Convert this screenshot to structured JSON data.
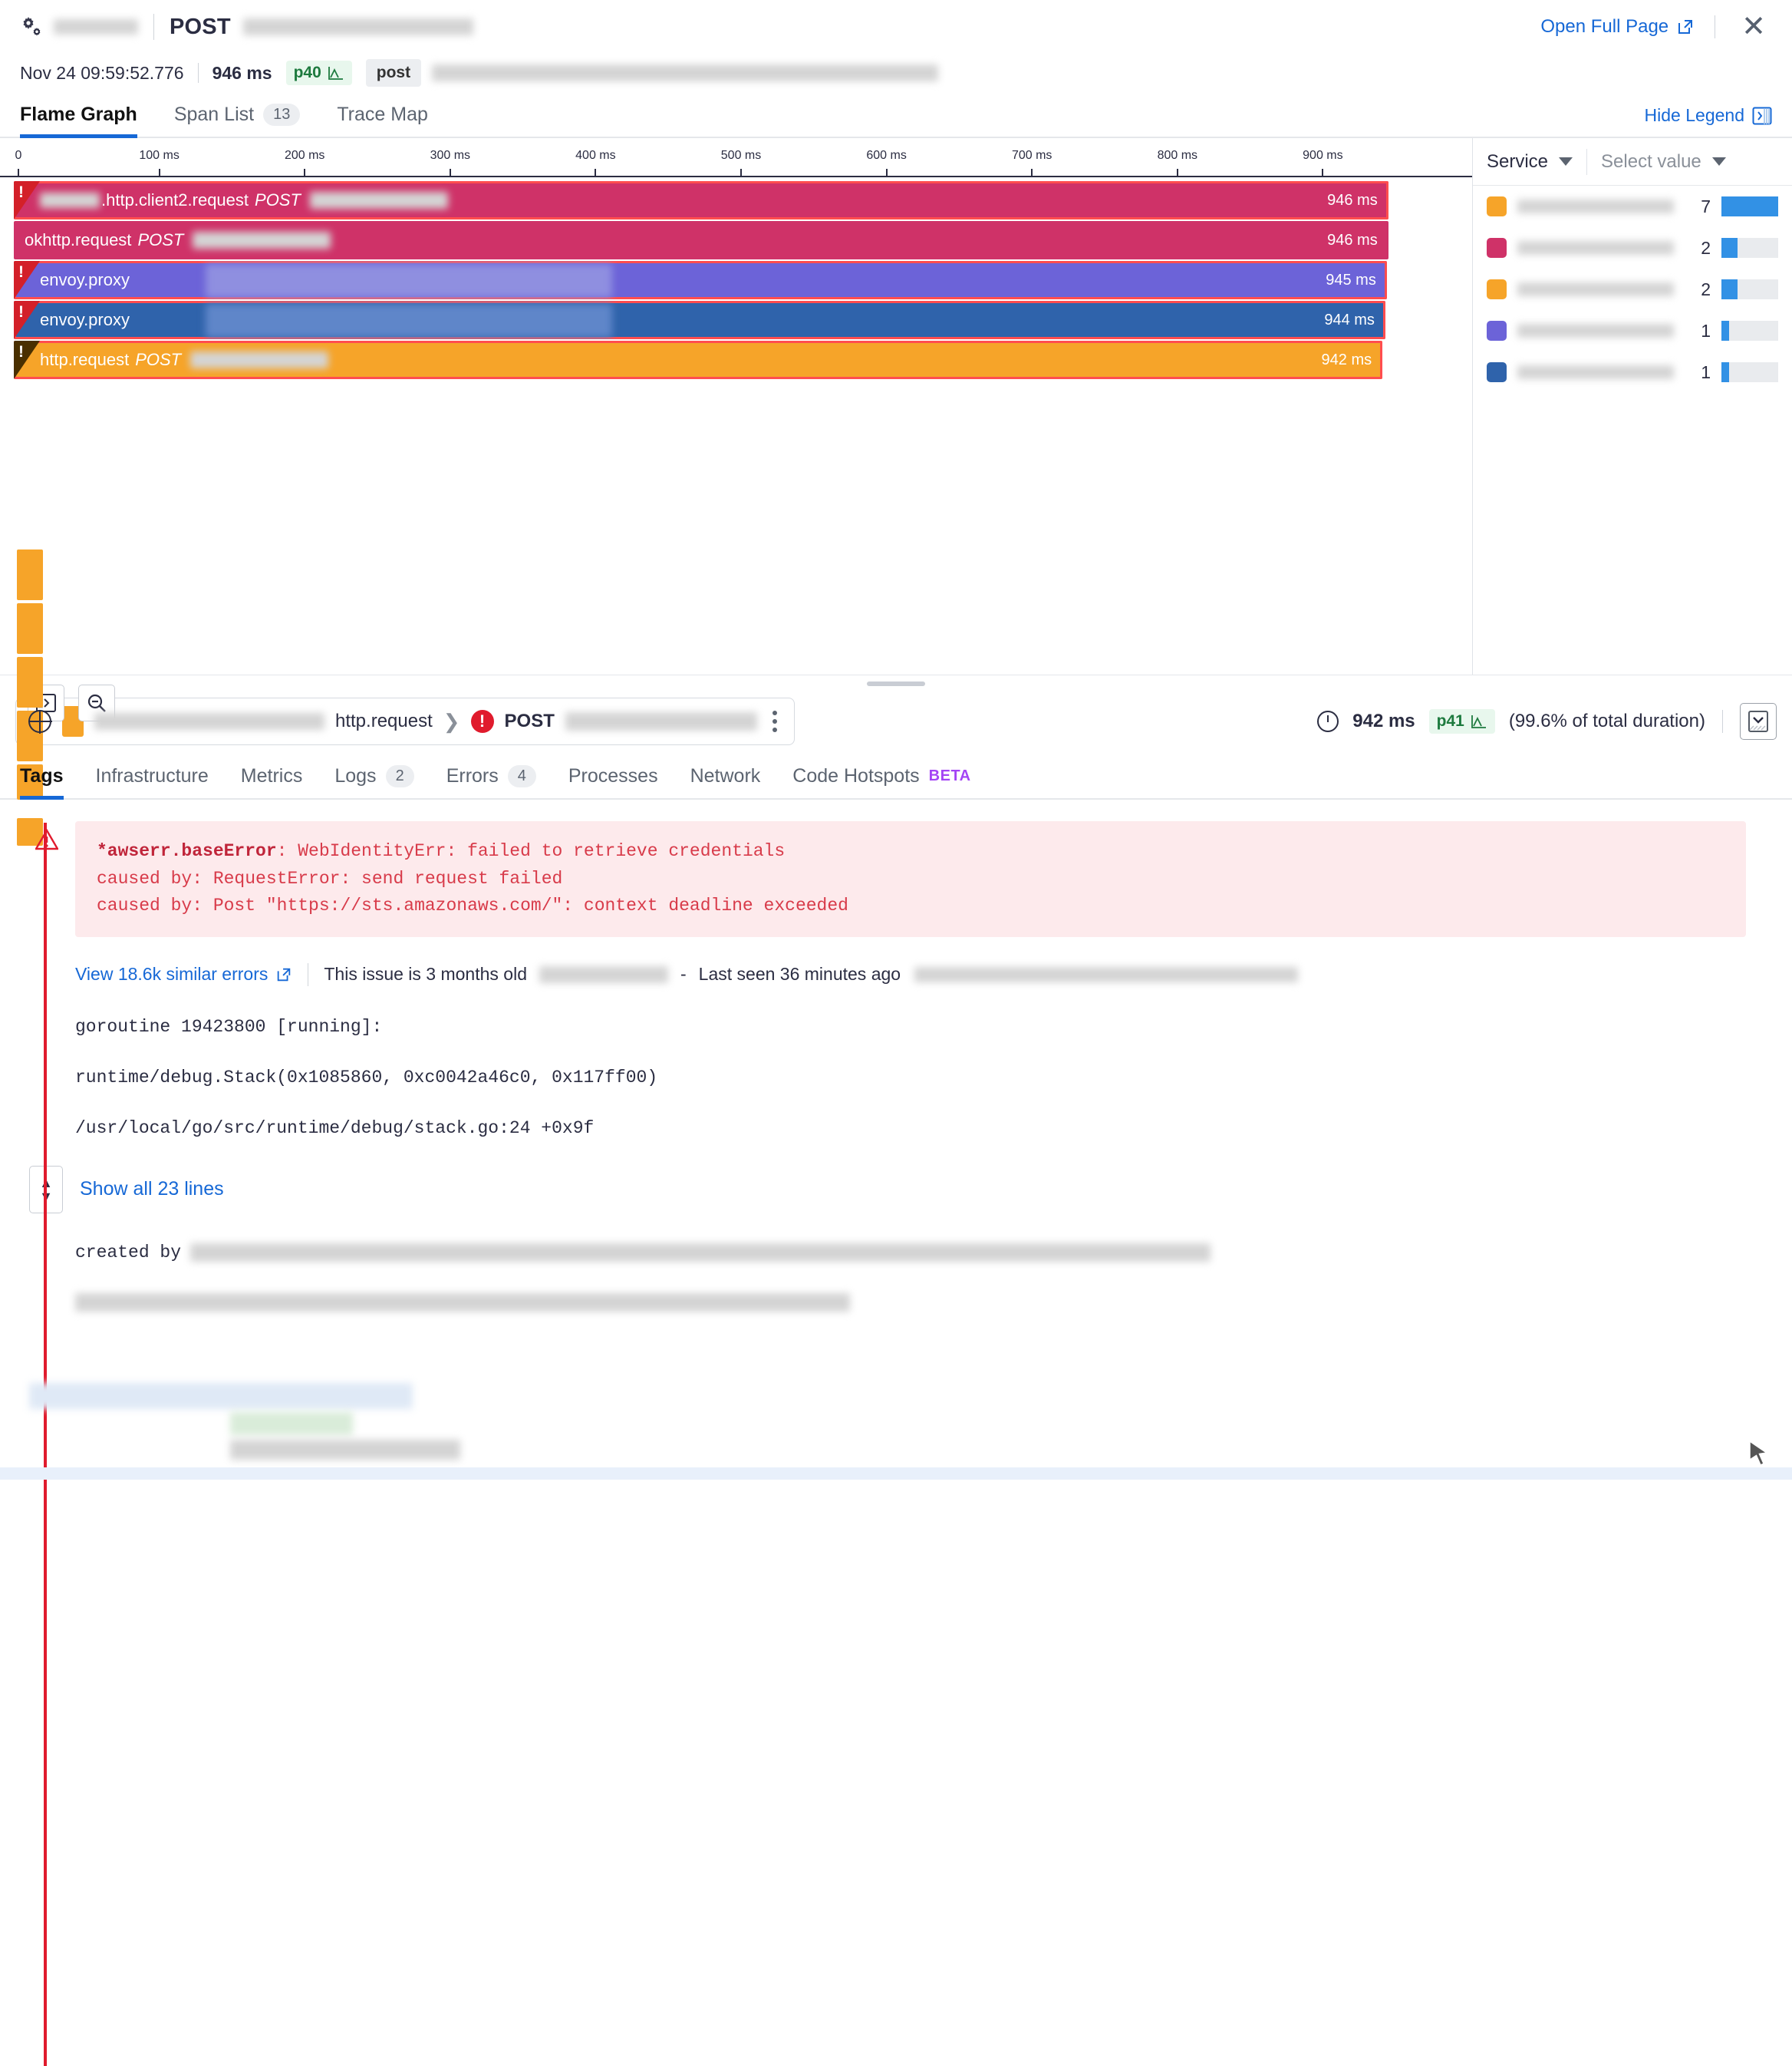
{
  "header": {
    "service_name_redacted": true,
    "method": "POST",
    "resource_redacted": true,
    "open_full_page": "Open Full Page",
    "close_icon": "close-icon",
    "settings_icon": "gears-icon"
  },
  "meta": {
    "timestamp": "Nov 24 09:59:52.776",
    "duration": "946 ms",
    "percentile_badge": "p40",
    "type_chip": "post"
  },
  "trace_tabs": {
    "items": [
      {
        "label": "Flame Graph",
        "count": null,
        "active": true
      },
      {
        "label": "Span List",
        "count": "13",
        "active": false
      },
      {
        "label": "Trace Map",
        "count": null,
        "active": false
      }
    ],
    "hide_legend": "Hide Legend"
  },
  "flame_graph": {
    "axis": {
      "ticks": [
        "0",
        "100 ms",
        "200 ms",
        "300 ms",
        "400 ms",
        "500 ms",
        "600 ms",
        "700 ms",
        "800 ms",
        "900 ms"
      ],
      "max_ms": 1000
    },
    "spans": [
      {
        "name": ".http.client2.request",
        "method": "POST",
        "duration": "946 ms",
        "duration_ms": 946,
        "start_ms": 0,
        "color": "#cf3268",
        "error": true,
        "redacted_prefix": true,
        "redacted_resource": true
      },
      {
        "name": "okhttp.request",
        "method": "POST",
        "duration": "946 ms",
        "duration_ms": 946,
        "start_ms": 0,
        "color": "#cf3268",
        "error": false,
        "redacted_prefix": false,
        "redacted_resource": true
      },
      {
        "name": "envoy.proxy",
        "method": "",
        "duration": "945 ms",
        "duration_ms": 945,
        "start_ms": 0,
        "color": "#6c63d8",
        "error": true,
        "redacted_prefix": false,
        "redacted_resource": false
      },
      {
        "name": "envoy.proxy",
        "method": "",
        "duration": "944 ms",
        "duration_ms": 944,
        "start_ms": 0,
        "color": "#2f63ab",
        "error": true,
        "redacted_prefix": false,
        "redacted_resource": false
      },
      {
        "name": "http.request",
        "method": "POST",
        "duration": "942 ms",
        "duration_ms": 942,
        "start_ms": 0,
        "color": "#f6a429",
        "error": true,
        "redacted_prefix": false,
        "redacted_resource": true,
        "selected": true
      }
    ],
    "controls": {
      "expand_icon": "expand-collapse-icon",
      "zoom_out_icon": "zoom-out-icon"
    }
  },
  "legend": {
    "group_by": "Service",
    "value_placeholder": "Select value",
    "rows": [
      {
        "color": "#f6a429",
        "count": "7",
        "bar_pct": 100
      },
      {
        "color": "#cf3268",
        "count": "2",
        "bar_pct": 28
      },
      {
        "color": "#f6a429",
        "count": "2",
        "bar_pct": 28
      },
      {
        "color": "#6c63d8",
        "count": "1",
        "bar_pct": 14
      },
      {
        "color": "#2f63ab",
        "count": "1",
        "bar_pct": 14
      }
    ]
  },
  "span_detail": {
    "globe_icon": "globe-icon",
    "operation": "http.request",
    "method": "POST",
    "error_icon": "error-badge-icon",
    "kebab_icon": "kebab-menu-icon",
    "clock_icon": "clock-icon",
    "duration": "942 ms",
    "percentile_badge": "p41",
    "percent_of_total": "(99.6% of total duration)",
    "collapse_icon": "collapse-panel-icon"
  },
  "detail_tabs": {
    "items": [
      {
        "label": "Tags",
        "count": null,
        "active": true,
        "beta": false
      },
      {
        "label": "Infrastructure",
        "count": null,
        "active": false,
        "beta": false
      },
      {
        "label": "Metrics",
        "count": null,
        "active": false,
        "beta": false
      },
      {
        "label": "Logs",
        "count": "2",
        "active": false,
        "beta": false
      },
      {
        "label": "Errors",
        "count": "4",
        "active": false,
        "beta": false
      },
      {
        "label": "Processes",
        "count": null,
        "active": false,
        "beta": false
      },
      {
        "label": "Network",
        "count": null,
        "active": false,
        "beta": false
      },
      {
        "label": "Code Hotspots",
        "count": null,
        "active": false,
        "beta": true,
        "beta_label": "BETA"
      }
    ]
  },
  "error_panel": {
    "warning_icon": "warning-triangle-icon",
    "lines": [
      {
        "bold_prefix": "*awserr.baseError",
        "rest": ": WebIdentityErr: failed to retrieve credentials"
      },
      {
        "bold_prefix": "",
        "rest": "caused by: RequestError: send request failed"
      },
      {
        "bold_prefix": "",
        "rest": "caused by: Post \"https://sts.amazonaws.com/\": context deadline exceeded"
      }
    ],
    "view_similar": "View 18.6k similar errors",
    "issue_age": "This issue is 3 months old",
    "dash": "-",
    "last_seen": "Last seen 36 minutes ago",
    "stack_lines": [
      "goroutine 19423800 [running]:",
      "runtime/debug.Stack(0x1085860, 0xc0042a46c0, 0x117ff00)",
      "/usr/local/go/src/runtime/debug/stack.go:24 +0x9f"
    ],
    "show_all": "Show all 23 lines",
    "expand_icon": "expand-collapse-stack-icon",
    "created_by": "created by"
  },
  "colors": {
    "accent_blue": "#1668d6",
    "error_red": "#e01b2d",
    "badge_green_bg": "#e8f7ed",
    "badge_green_fg": "#1d7a3e",
    "beta_purple": "#a445f5"
  }
}
